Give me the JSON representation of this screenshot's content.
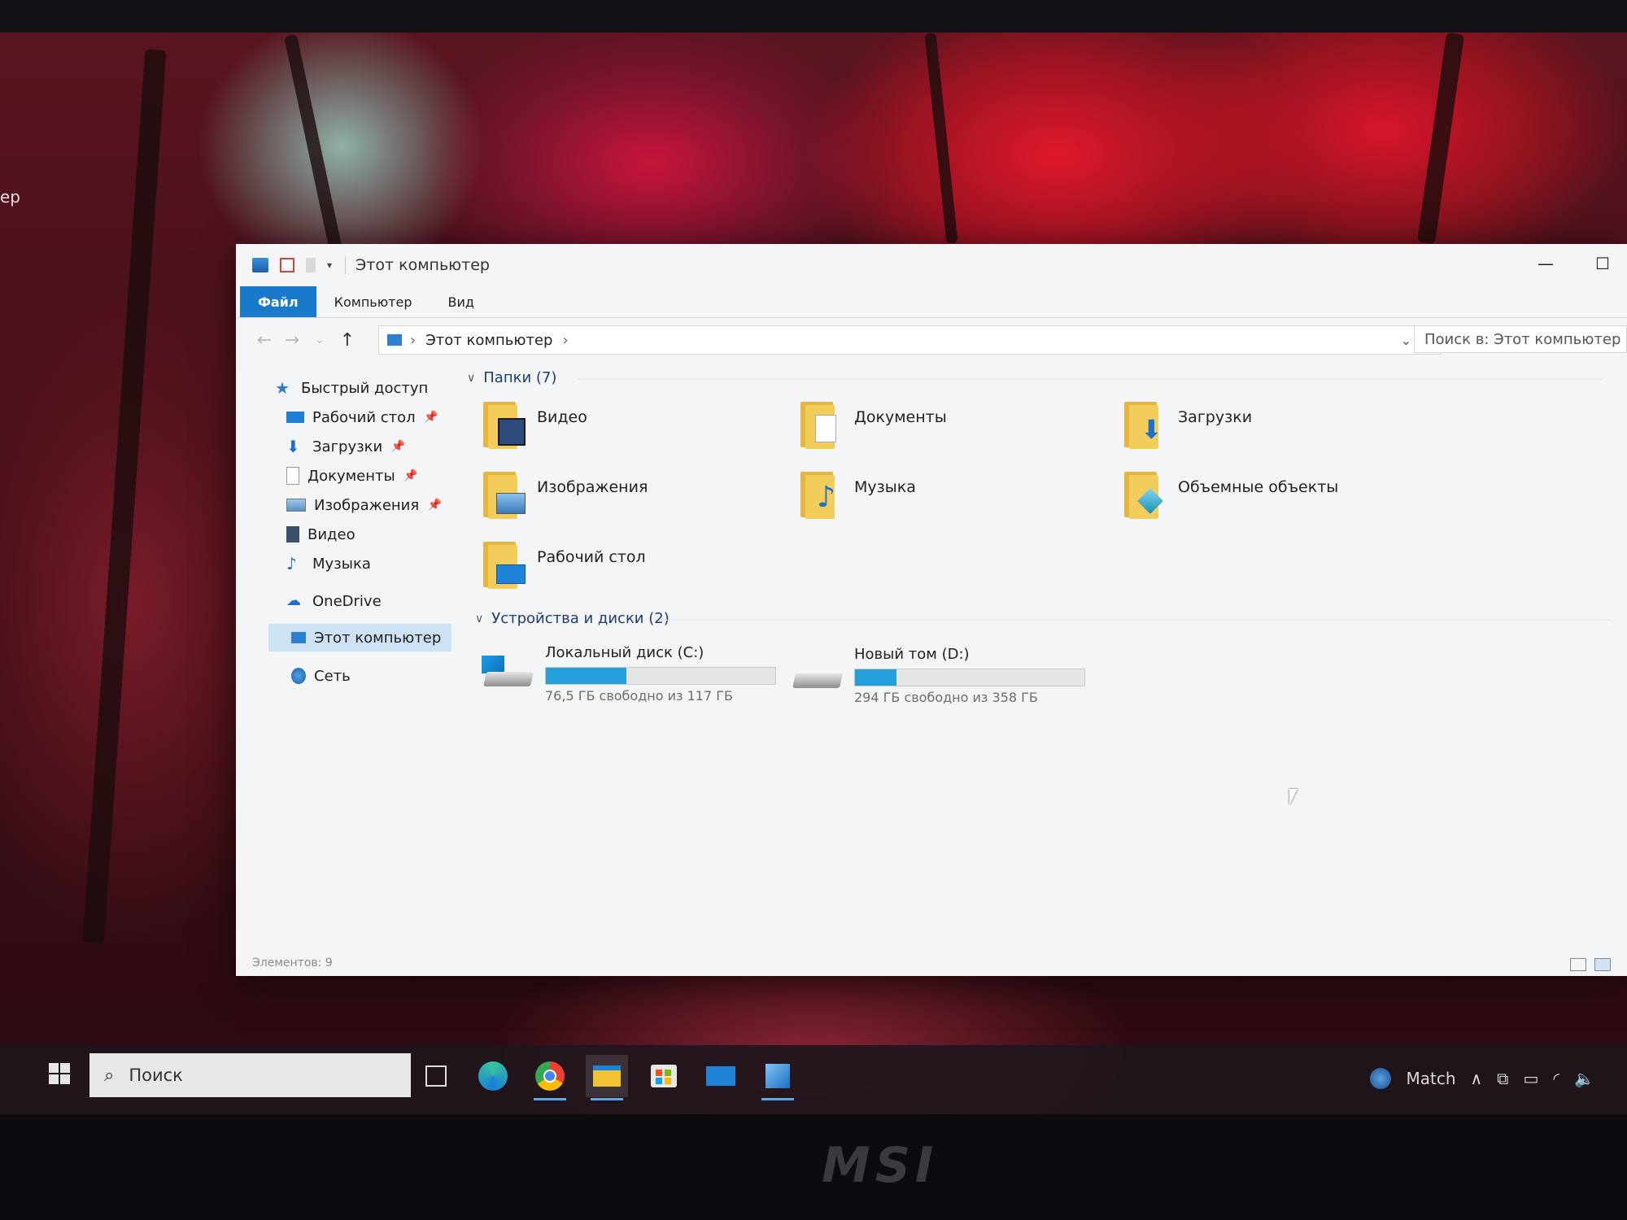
{
  "desktop": {
    "side_text": "ер"
  },
  "window": {
    "title": "Этот компьютер",
    "controls": {
      "minimize": "—",
      "maximize": "☐"
    },
    "ribbon_tabs": [
      "Файл",
      "Компьютер",
      "Вид"
    ],
    "address": {
      "root": "Этот компьютер"
    },
    "search_placeholder": "Поиск в: Этот компьютер"
  },
  "navpane": {
    "quick_access": "Быстрый доступ",
    "quick_items": [
      "Рабочий стол",
      "Загрузки",
      "Документы",
      "Изображения",
      "Видео",
      "Музыка"
    ],
    "onedrive": "OneDrive",
    "this_pc": "Этот компьютер",
    "network": "Сеть"
  },
  "content": {
    "folders_header": "Папки (7)",
    "folders": [
      "Видео",
      "Документы",
      "Загрузки",
      "Изображения",
      "Музыка",
      "Объемные объекты",
      "Рабочий стол"
    ],
    "drives_header": "Устройства и диски (2)",
    "drives": [
      {
        "name": "Локальный диск (C:)",
        "free": "76,5 ГБ свободно из 117 ГБ",
        "used_fraction": 0.35
      },
      {
        "name": "Новый том (D:)",
        "free": "294 ГБ свободно из 358 ГБ",
        "used_fraction": 0.18
      }
    ]
  },
  "status": {
    "items": "Элементов: 9"
  },
  "taskbar": {
    "search_text": "Поиск",
    "weather": "Match",
    "icons": [
      "task-view-icon",
      "edge-icon",
      "chrome-icon",
      "file-explorer-icon",
      "store-icon",
      "mail-icon",
      "photos-icon"
    ]
  },
  "bezel": {
    "brand": "MSI"
  },
  "colors": {
    "accent": "#1979ca",
    "drive_bar": "#26a0da",
    "folder": "#f3cd5c"
  }
}
